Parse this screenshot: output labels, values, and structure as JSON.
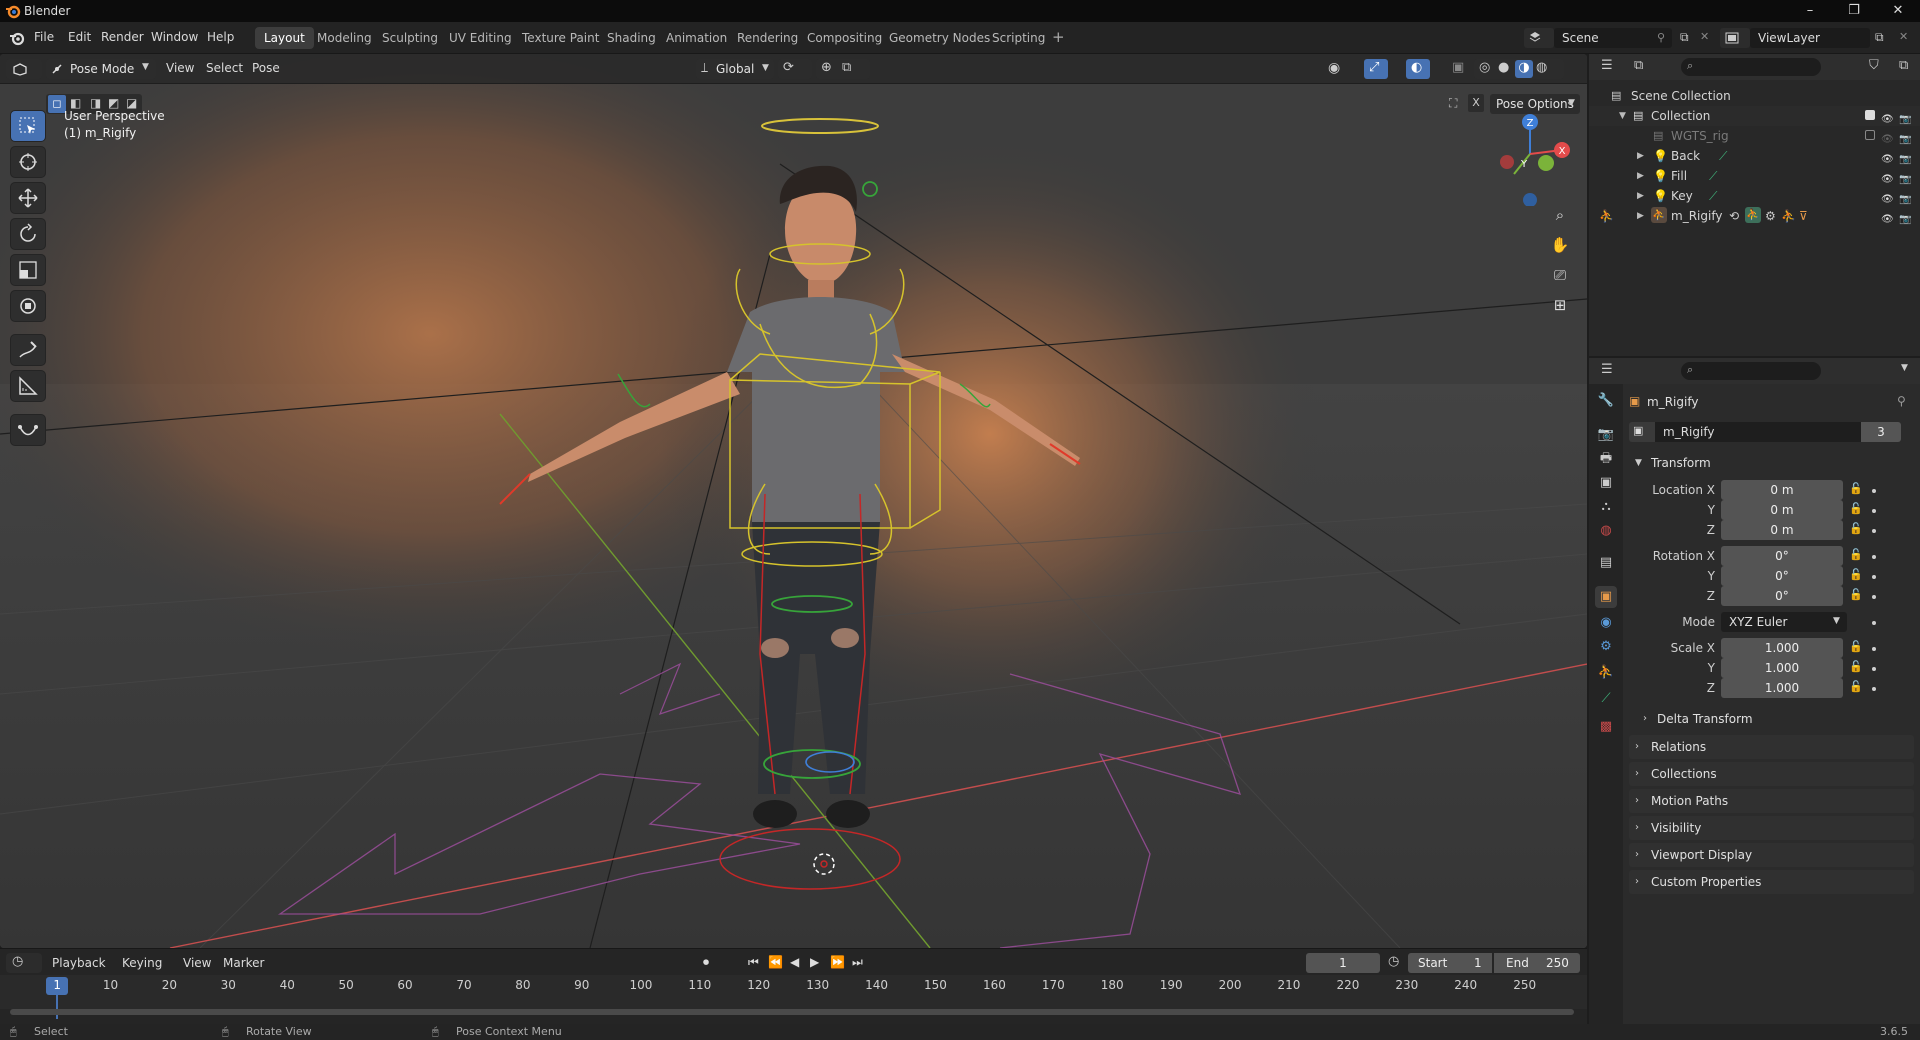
{
  "app": {
    "title": "Blender",
    "version": "3.6.5"
  },
  "window_controls": {
    "minimize": "–",
    "maximize": "❐",
    "close": "✕"
  },
  "menus": [
    "File",
    "Edit",
    "Render",
    "Window",
    "Help"
  ],
  "workspaces": [
    "Layout",
    "Modeling",
    "Sculpting",
    "UV Editing",
    "Texture Paint",
    "Shading",
    "Animation",
    "Rendering",
    "Compositing",
    "Geometry Nodes",
    "Scripting"
  ],
  "active_workspace": "Layout",
  "add_workspace": "+",
  "scene": {
    "name": "Scene",
    "view_layer": "ViewLayer"
  },
  "viewport": {
    "mode": "Pose Mode",
    "menus": [
      "View",
      "Select",
      "Pose"
    ],
    "orientation": "Global",
    "pose_options": "Pose Options",
    "overlay_title": "User Perspective",
    "overlay_object": "(1) m_Rigify",
    "gizmo": {
      "x": "X",
      "y": "Y",
      "z": "Z"
    },
    "nav_icons": [
      "zoom-icon",
      "hand-icon",
      "camera-icon",
      "grid-icon"
    ]
  },
  "outliner": {
    "root": "Scene Collection",
    "collection": "Collection",
    "items": [
      {
        "name": "WGTS_rig",
        "dim": true
      },
      {
        "name": "Back",
        "dim": false
      },
      {
        "name": "Fill",
        "dim": false
      },
      {
        "name": "Key",
        "dim": false
      },
      {
        "name": "m_Rigify",
        "dim": false
      }
    ]
  },
  "properties": {
    "object_name": "m_Rigify",
    "data_name": "m_Rigify",
    "users": "3",
    "transform_label": "Transform",
    "location_label": "Location X",
    "rotation_label": "Rotation X",
    "mode_label": "Mode",
    "scale_label": "Scale X",
    "y_label": "Y",
    "z_label": "Z",
    "location": [
      "0 m",
      "0 m",
      "0 m"
    ],
    "rotation": [
      "0°",
      "0°",
      "0°"
    ],
    "rotation_mode": "XYZ Euler",
    "scale": [
      "1.000",
      "1.000",
      "1.000"
    ],
    "delta_transform": "Delta Transform",
    "panels": [
      "Relations",
      "Collections",
      "Motion Paths",
      "Visibility",
      "Viewport Display",
      "Custom Properties"
    ]
  },
  "timeline": {
    "menus": [
      "Playback",
      "Keying",
      "View",
      "Marker"
    ],
    "current_frame": "1",
    "start_label": "Start",
    "start": "1",
    "end_label": "End",
    "end": "250",
    "ticks": [
      "1",
      "10",
      "20",
      "30",
      "40",
      "50",
      "60",
      "70",
      "80",
      "90",
      "100",
      "110",
      "120",
      "130",
      "140",
      "150",
      "160",
      "170",
      "180",
      "190",
      "200",
      "210",
      "220",
      "230",
      "240",
      "250"
    ]
  },
  "statusbar": {
    "select": "Select",
    "rotate": "Rotate View",
    "context": "Pose Context Menu"
  },
  "colors": {
    "accent": "#4772b3",
    "bg": "#1d1d1d",
    "x_axis": "#e34b4b",
    "y_axis": "#7bb33a",
    "z_axis": "#3f7fd8"
  }
}
